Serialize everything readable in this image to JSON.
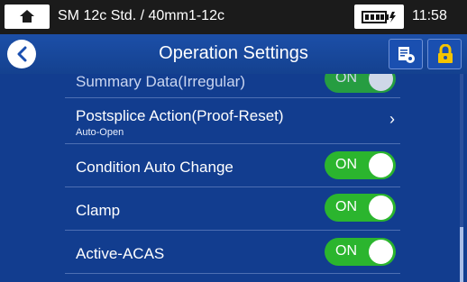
{
  "status": {
    "recipe": "SM 12c Std. / 40mm1-12c",
    "time": "11:58"
  },
  "header": {
    "title": "Operation Settings"
  },
  "settings": {
    "summary": {
      "label": "Summary Data(Irregular)",
      "toggle": "ON"
    },
    "postsplice": {
      "label": "Postsplice Action(Proof-Reset)",
      "value": "Auto-Open",
      "chevron": "›"
    },
    "condition": {
      "label": "Condition Auto Change",
      "toggle": "ON"
    },
    "clamp": {
      "label": "Clamp",
      "toggle": "ON"
    },
    "acas": {
      "label": "Active-ACAS",
      "toggle": "ON"
    }
  },
  "colors": {
    "toggle_on": "#2bb52e",
    "lock": "#f5c400",
    "background": "#123d8f"
  },
  "icons": [
    "home-icon",
    "battery-icon",
    "back-icon",
    "settings-list-icon",
    "lock-icon"
  ]
}
